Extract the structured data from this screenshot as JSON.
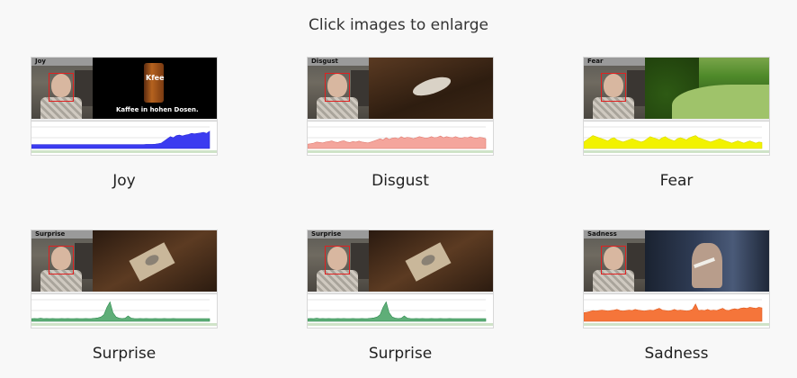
{
  "header": {
    "title": "Click images to enlarge"
  },
  "items": [
    {
      "tag": "Joy",
      "label": "Joy",
      "color": "#2b2bd9",
      "fill": "#3b3bf0",
      "scene": "joy",
      "video_text": {
        "can": "Kfee",
        "slogan": "Kaffee in hohen Dosen."
      },
      "series": [
        0.18,
        0.18,
        0.18,
        0.18,
        0.18,
        0.18,
        0.18,
        0.18,
        0.18,
        0.18,
        0.18,
        0.18,
        0.18,
        0.18,
        0.18,
        0.18,
        0.18,
        0.18,
        0.18,
        0.18,
        0.18,
        0.18,
        0.18,
        0.18,
        0.18,
        0.18,
        0.18,
        0.18,
        0.18,
        0.18,
        0.18,
        0.18,
        0.18,
        0.18,
        0.18,
        0.18,
        0.18,
        0.18,
        0.19,
        0.19,
        0.19,
        0.2,
        0.22,
        0.25,
        0.35,
        0.45,
        0.55,
        0.5,
        0.6,
        0.62,
        0.58,
        0.62,
        0.65,
        0.7,
        0.68,
        0.7,
        0.72,
        0.75,
        0.7,
        0.8
      ]
    },
    {
      "tag": "Disgust",
      "label": "Disgust",
      "color": "#e07a70",
      "fill": "#f4a59c",
      "scene": "disgust",
      "series": [
        0.2,
        0.22,
        0.25,
        0.3,
        0.28,
        0.26,
        0.3,
        0.32,
        0.35,
        0.3,
        0.28,
        0.33,
        0.36,
        0.3,
        0.28,
        0.32,
        0.3,
        0.34,
        0.3,
        0.28,
        0.26,
        0.3,
        0.35,
        0.4,
        0.45,
        0.4,
        0.5,
        0.42,
        0.48,
        0.5,
        0.45,
        0.55,
        0.48,
        0.52,
        0.5,
        0.45,
        0.5,
        0.55,
        0.52,
        0.48,
        0.5,
        0.55,
        0.5,
        0.52,
        0.58,
        0.5,
        0.55,
        0.52,
        0.5,
        0.55,
        0.5,
        0.48,
        0.52,
        0.5,
        0.55,
        0.5,
        0.48,
        0.52,
        0.5,
        0.45
      ]
    },
    {
      "tag": "Fear",
      "label": "Fear",
      "color": "#d8d800",
      "fill": "#f2f200",
      "scene": "fear",
      "series": [
        0.3,
        0.4,
        0.5,
        0.6,
        0.55,
        0.5,
        0.45,
        0.4,
        0.35,
        0.45,
        0.5,
        0.4,
        0.35,
        0.3,
        0.35,
        0.4,
        0.45,
        0.4,
        0.35,
        0.3,
        0.35,
        0.45,
        0.55,
        0.5,
        0.45,
        0.4,
        0.5,
        0.55,
        0.45,
        0.4,
        0.35,
        0.45,
        0.5,
        0.45,
        0.4,
        0.5,
        0.55,
        0.6,
        0.5,
        0.45,
        0.4,
        0.35,
        0.3,
        0.35,
        0.4,
        0.45,
        0.4,
        0.35,
        0.3,
        0.25,
        0.3,
        0.35,
        0.3,
        0.25,
        0.3,
        0.35,
        0.3,
        0.25,
        0.3,
        0.28
      ]
    },
    {
      "tag": "Surprise",
      "label": "Surprise",
      "color": "#2e8b4f",
      "fill": "#5fae78",
      "scene": "trap",
      "series": [
        0.12,
        0.13,
        0.12,
        0.14,
        0.12,
        0.13,
        0.12,
        0.13,
        0.12,
        0.12,
        0.13,
        0.12,
        0.13,
        0.12,
        0.12,
        0.13,
        0.12,
        0.12,
        0.13,
        0.12,
        0.13,
        0.14,
        0.16,
        0.2,
        0.3,
        0.65,
        0.9,
        0.4,
        0.2,
        0.15,
        0.13,
        0.14,
        0.25,
        0.15,
        0.13,
        0.12,
        0.13,
        0.12,
        0.13,
        0.12,
        0.12,
        0.13,
        0.12,
        0.12,
        0.13,
        0.12,
        0.12,
        0.13,
        0.12,
        0.12,
        0.12,
        0.12,
        0.12,
        0.12,
        0.12,
        0.12,
        0.12,
        0.12,
        0.12,
        0.12
      ]
    },
    {
      "tag": "Surprise",
      "label": "Surprise",
      "color": "#2e8b4f",
      "fill": "#5fae78",
      "scene": "trap",
      "series": [
        0.12,
        0.13,
        0.12,
        0.14,
        0.12,
        0.13,
        0.12,
        0.13,
        0.12,
        0.12,
        0.13,
        0.12,
        0.13,
        0.12,
        0.12,
        0.13,
        0.12,
        0.12,
        0.13,
        0.12,
        0.13,
        0.14,
        0.16,
        0.2,
        0.3,
        0.65,
        0.9,
        0.4,
        0.2,
        0.15,
        0.13,
        0.14,
        0.25,
        0.15,
        0.13,
        0.12,
        0.13,
        0.12,
        0.13,
        0.12,
        0.12,
        0.13,
        0.12,
        0.12,
        0.13,
        0.12,
        0.12,
        0.13,
        0.12,
        0.12,
        0.12,
        0.12,
        0.12,
        0.12,
        0.12,
        0.12,
        0.12,
        0.12,
        0.12,
        0.12
      ]
    },
    {
      "tag": "Sadness",
      "label": "Sadness",
      "color": "#e05a1e",
      "fill": "#f5753a",
      "scene": "sad",
      "series": [
        0.4,
        0.42,
        0.45,
        0.5,
        0.48,
        0.5,
        0.52,
        0.5,
        0.48,
        0.5,
        0.52,
        0.55,
        0.5,
        0.48,
        0.5,
        0.52,
        0.5,
        0.55,
        0.52,
        0.5,
        0.48,
        0.5,
        0.52,
        0.5,
        0.55,
        0.6,
        0.52,
        0.5,
        0.48,
        0.5,
        0.55,
        0.5,
        0.52,
        0.5,
        0.48,
        0.5,
        0.55,
        0.8,
        0.5,
        0.52,
        0.5,
        0.55,
        0.5,
        0.52,
        0.5,
        0.55,
        0.6,
        0.52,
        0.5,
        0.55,
        0.58,
        0.55,
        0.6,
        0.62,
        0.6,
        0.65,
        0.62,
        0.6,
        0.65,
        0.62
      ]
    }
  ]
}
